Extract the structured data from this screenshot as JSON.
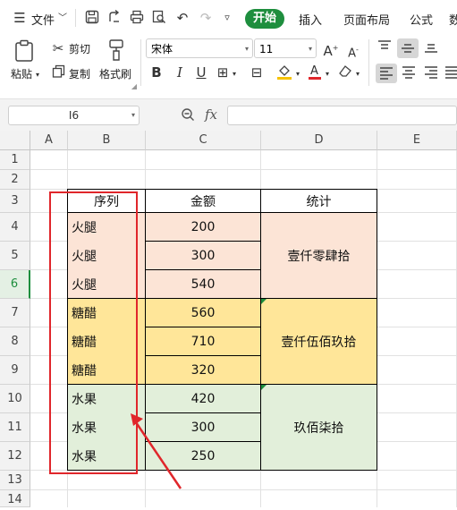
{
  "menubar": {
    "file_label": "文件",
    "tabs": [
      {
        "label": "开始",
        "active": true
      },
      {
        "label": "插入"
      },
      {
        "label": "页面布局"
      },
      {
        "label": "公式"
      },
      {
        "label": "数"
      }
    ]
  },
  "ribbon": {
    "paste_label": "粘贴",
    "cut_label": "剪切",
    "copy_label": "复制",
    "format_painter_label": "格式刷",
    "font_name": "宋体",
    "font_size": "11"
  },
  "formula_bar": {
    "name_box": "I6",
    "fx_label": "fx",
    "content": ""
  },
  "sheet": {
    "columns": [
      "A",
      "B",
      "C",
      "D",
      "E"
    ],
    "rows": [
      "1",
      "2",
      "3",
      "4",
      "5",
      "6",
      "7",
      "8",
      "9",
      "10",
      "11",
      "12",
      "13",
      "14"
    ],
    "selected_row": "6",
    "table": {
      "headers": [
        "序列",
        "金额",
        "统计"
      ],
      "rows": [
        {
          "item": "火腿",
          "amount": "200"
        },
        {
          "item": "火腿",
          "amount": "300"
        },
        {
          "item": "火腿",
          "amount": "540"
        },
        {
          "item": "糖醋",
          "amount": "560"
        },
        {
          "item": "糖醋",
          "amount": "710"
        },
        {
          "item": "糖醋",
          "amount": "320"
        },
        {
          "item": "水果",
          "amount": "420"
        },
        {
          "item": "水果",
          "amount": "300"
        },
        {
          "item": "水果",
          "amount": "250"
        }
      ],
      "totals": [
        "壹仟零肆拾",
        "壹仟伍佰玖拾",
        "玖佰柒拾"
      ]
    }
  },
  "colors": {
    "accent": "#1e8e3e",
    "group1_fill": "#fce4d6",
    "group2_fill": "#ffe699",
    "group3_fill": "#e2efda",
    "annotation_red": "#e0262b"
  }
}
